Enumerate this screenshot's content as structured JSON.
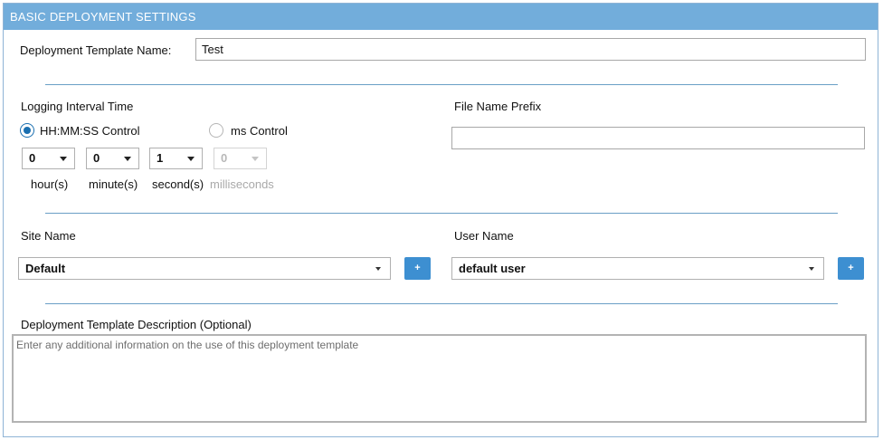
{
  "header": {
    "title": "BASIC DEPLOYMENT SETTINGS"
  },
  "template_name": {
    "label": "Deployment Template Name:",
    "value": "Test"
  },
  "logging": {
    "title": "Logging Interval Time",
    "radio_hms": "HH:MM:SS Control",
    "radio_ms": "ms Control",
    "selected": "HH:MM:SS Control",
    "hour": {
      "value": "0",
      "label": "hour(s)"
    },
    "minute": {
      "value": "0",
      "label": "minute(s)"
    },
    "second": {
      "value": "1",
      "label": "second(s)"
    },
    "milliseconds": {
      "value": "0",
      "label": "milliseconds"
    }
  },
  "file_prefix": {
    "label": "File Name Prefix",
    "value": ""
  },
  "site": {
    "label": "Site Name",
    "value": "Default",
    "add_label": "+"
  },
  "user": {
    "label": "User Name",
    "value": "default user",
    "add_label": "+"
  },
  "description": {
    "label": "Deployment Template Description (Optional)",
    "placeholder": "Enter any additional information on the use of this deployment template"
  },
  "colors": {
    "header_bg": "#72addb",
    "accent": "#1a6fb0",
    "button_bg": "#3d8fd1",
    "divider": "#6a9fc6"
  }
}
